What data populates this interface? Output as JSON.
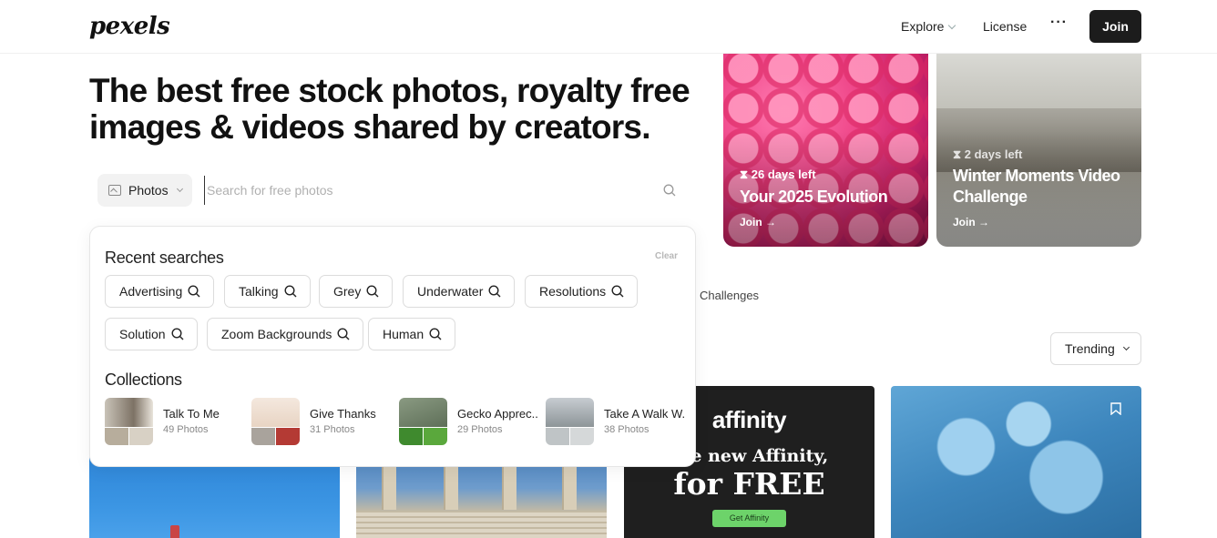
{
  "header": {
    "logo": "pexels",
    "nav": {
      "explore": "Explore",
      "license": "License",
      "more": "···",
      "join": "Join"
    }
  },
  "hero": {
    "title": "The best free stock photos, royalty free images & videos shared by creators."
  },
  "search": {
    "type_label": "Photos",
    "placeholder": "Search for free photos",
    "value": ""
  },
  "dropdown": {
    "recent_heading": "Recent searches",
    "clear_label": "Clear",
    "recent_searches": [
      "Advertising",
      "Talking",
      "Grey",
      "Underwater",
      "Resolutions",
      "Solution",
      "Zoom Backgrounds",
      "Human"
    ],
    "collections_heading": "Collections",
    "collections": [
      {
        "name": "Talk To Me",
        "count": "49 Photos"
      },
      {
        "name": "Give Thanks",
        "count": "31 Photos"
      },
      {
        "name": "Gecko Apprec...",
        "count": "29 Photos"
      },
      {
        "name": "Take A Walk W...",
        "count": "38 Photos"
      }
    ]
  },
  "challenges": [
    {
      "days_left": "26 days left",
      "title": "Your 2025 Evolution",
      "cta": "Join →"
    },
    {
      "days_left": "2 days left",
      "title": "Winter Moments Video Challenge",
      "cta": "Join →"
    }
  ],
  "tabs": {
    "challenges": "Challenges"
  },
  "sort": {
    "selected": "Trending"
  },
  "ad": {
    "logo": "affinity",
    "line1": "the new Affinity,",
    "line2": "for FREE",
    "button": "Get Affinity"
  },
  "colors": {
    "primary_dark": "#1c1c1c",
    "accent_green": "#6dd36a"
  }
}
